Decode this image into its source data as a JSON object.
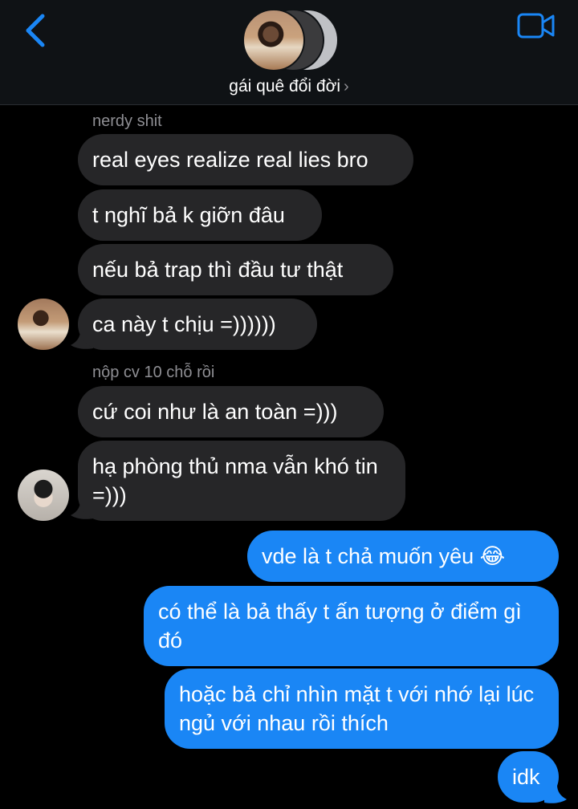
{
  "header": {
    "group_name": "gái quê đổi đời",
    "chevron": "›",
    "back_icon": "chevron-left-icon",
    "video_icon": "video-camera-icon"
  },
  "colors": {
    "accent": "#1a86f5",
    "incoming_bubble": "#262628",
    "background": "#000000",
    "secondary_text": "#8e8e93"
  },
  "messages": {
    "group1_sender": "nerdy shit",
    "m1": "real eyes realize real lies bro",
    "m2": "t nghĩ bả k giỡn đâu",
    "m3": "nếu bả trap thì đầu tư thật",
    "m4": "ca này t chịu =))))))",
    "group2_sender": "nộp cv 10 chỗ rồi",
    "m5": "cứ coi như là an toàn =)))",
    "m6": "hạ phòng thủ nma vẫn khó tin =)))",
    "m7": "vde là t chả muốn yêu 😂",
    "m8": "có thể là bả thấy t ấn tượng ở điểm gì đó",
    "m9": "hoặc bả chỉ nhìn mặt t với nhớ lại lúc ngủ với nhau rồi thích",
    "m10": "idk"
  }
}
